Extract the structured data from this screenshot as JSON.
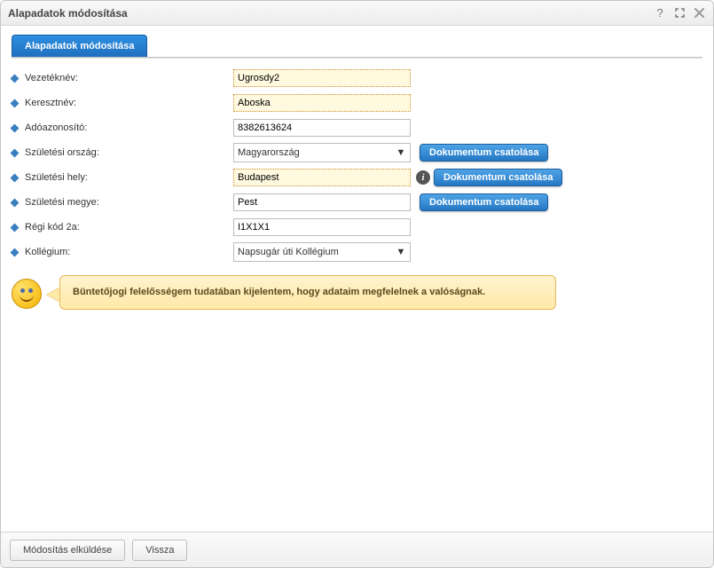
{
  "window": {
    "title": "Alapadatok módosítása"
  },
  "tab": {
    "label": "Alapadatok módosítása"
  },
  "labels": {
    "vezeteknev": "Vezetéknév:",
    "keresztnev": "Keresztnév:",
    "adoazonosito": "Adóazonosító:",
    "szul_orszag": "Születési ország:",
    "szul_hely": "Születési hely:",
    "szul_megye": "Születési megye:",
    "regi_kod": "Régi kód 2a:",
    "kollegium": "Kollégium:"
  },
  "values": {
    "vezeteknev": "Ugrosdy2",
    "keresztnev": "Aboska",
    "adoazonosito": "8382613624",
    "szul_orszag": "Magyarország",
    "szul_hely": "Budapest",
    "szul_megye": "Pest",
    "regi_kod": "I1X1X1",
    "kollegium": "Napsugár úti Kollégium"
  },
  "buttons": {
    "attach": "Dokumentum csatolása",
    "submit": "Módosítás elküldése",
    "back": "Vissza"
  },
  "notice": "Büntetőjogi felelősségem tudatában kijelentem, hogy adataim megfelelnek a valóságnak."
}
